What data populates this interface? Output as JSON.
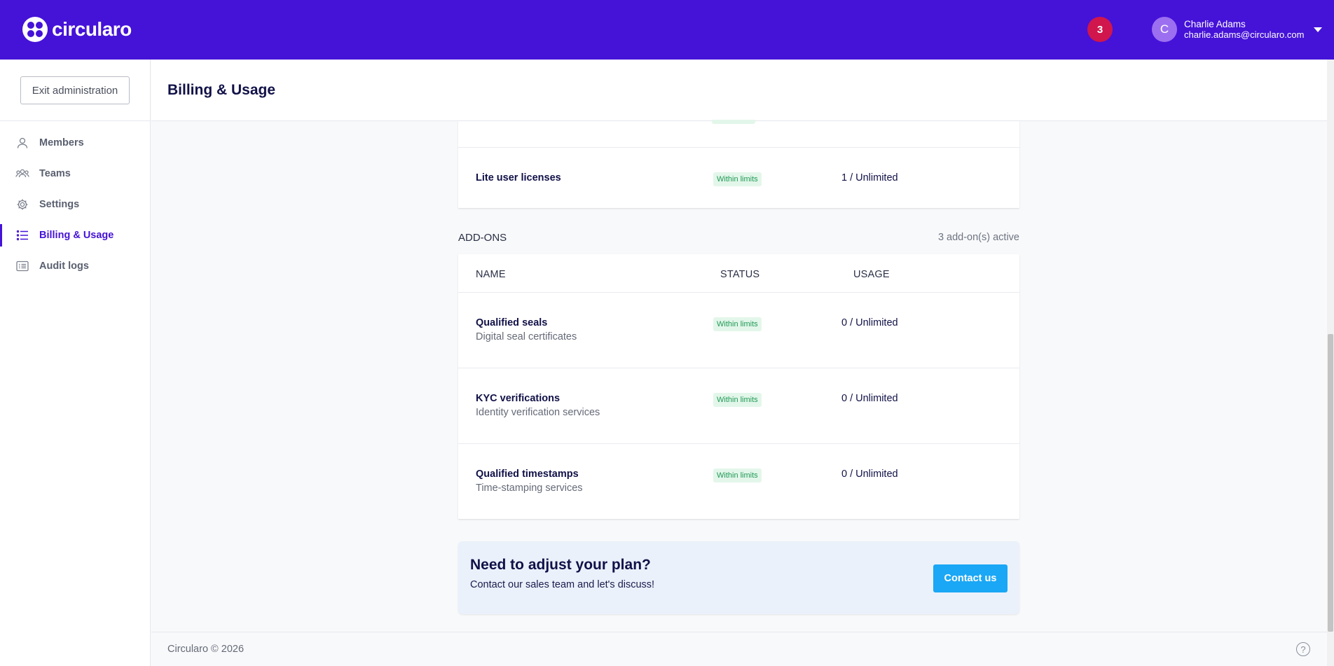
{
  "app": {
    "logo_text": "circularo",
    "notifications_count": "3",
    "user": {
      "initial": "C",
      "name": "Charlie Adams",
      "email": "charlie.adams@circularo.com"
    }
  },
  "sidebar": {
    "exit_label": "Exit administration",
    "items": [
      {
        "label": "Members",
        "icon": "person-icon"
      },
      {
        "label": "Teams",
        "icon": "people-icon"
      },
      {
        "label": "Settings",
        "icon": "gear-icon"
      },
      {
        "label": "Billing & Usage",
        "icon": "list-icon",
        "active": true
      },
      {
        "label": "Audit logs",
        "icon": "log-icon"
      }
    ]
  },
  "header": {
    "title": "Billing & Usage"
  },
  "licenses": {
    "rows": [
      {
        "name": "Lite user licenses",
        "status": "Within limits",
        "usage": "1 / Unlimited"
      }
    ]
  },
  "addons": {
    "section_label": "ADD-ONS",
    "active_count": "3 add-on(s) active",
    "columns": {
      "name": "NAME",
      "status": "STATUS",
      "usage": "USAGE"
    },
    "rows": [
      {
        "name": "Qualified seals",
        "description": "Digital seal certificates",
        "status": "Within limits",
        "usage": "0 / Unlimited"
      },
      {
        "name": "KYC verifications",
        "description": "Identity verification services",
        "status": "Within limits",
        "usage": "0 / Unlimited"
      },
      {
        "name": "Qualified timestamps",
        "description": "Time-stamping services",
        "status": "Within limits",
        "usage": "0 / Unlimited"
      }
    ]
  },
  "cta": {
    "title": "Need to adjust your plan?",
    "subtitle": "Contact our sales team and let's discuss!",
    "button_label": "Contact us"
  },
  "footer": {
    "copyright": "Circularo © 2026",
    "help_glyph": "?"
  },
  "colors": {
    "brand": "#4512d8",
    "badge": "#d0164c",
    "accent_button": "#1aa7f5",
    "status_ok": "#1f9a55"
  }
}
